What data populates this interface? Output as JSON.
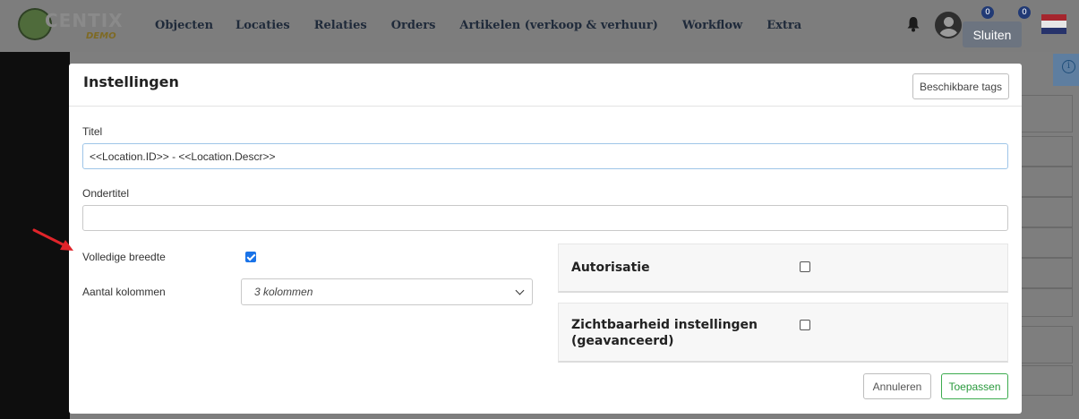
{
  "app": {
    "logo_text": "CENTIX",
    "logo_sub": "DEMO",
    "nav": [
      "Objecten",
      "Locaties",
      "Relaties",
      "Orders",
      "Artikelen (verkoop & verhuur)",
      "Workflow",
      "Extra"
    ],
    "badge1": "0",
    "badge2": "0",
    "close_label": "Sluiten"
  },
  "modal": {
    "title": "Instellingen",
    "tags_button": "Beschikbare tags",
    "title_label": "Titel",
    "title_value": "<<Location.ID>> - <<Location.Descr>>",
    "subtitle_label": "Ondertitel",
    "subtitle_value": "",
    "full_width_label": "Volledige breedte",
    "full_width_checked": true,
    "columns_label": "Aantal kolommen",
    "columns_value": "3 kolommen",
    "authorization_label": "Autorisatie",
    "authorization_checked": false,
    "visibility_label_line1": "Zichtbaarheid instellingen",
    "visibility_label_line2": "(geavanceerd)",
    "visibility_checked": false,
    "cancel_label": "Annuleren",
    "apply_label": "Toepassen"
  },
  "colors": {
    "accent": "#1a73e8",
    "apply_green": "#2a9a3d",
    "annotation_arrow": "#e0242a"
  }
}
